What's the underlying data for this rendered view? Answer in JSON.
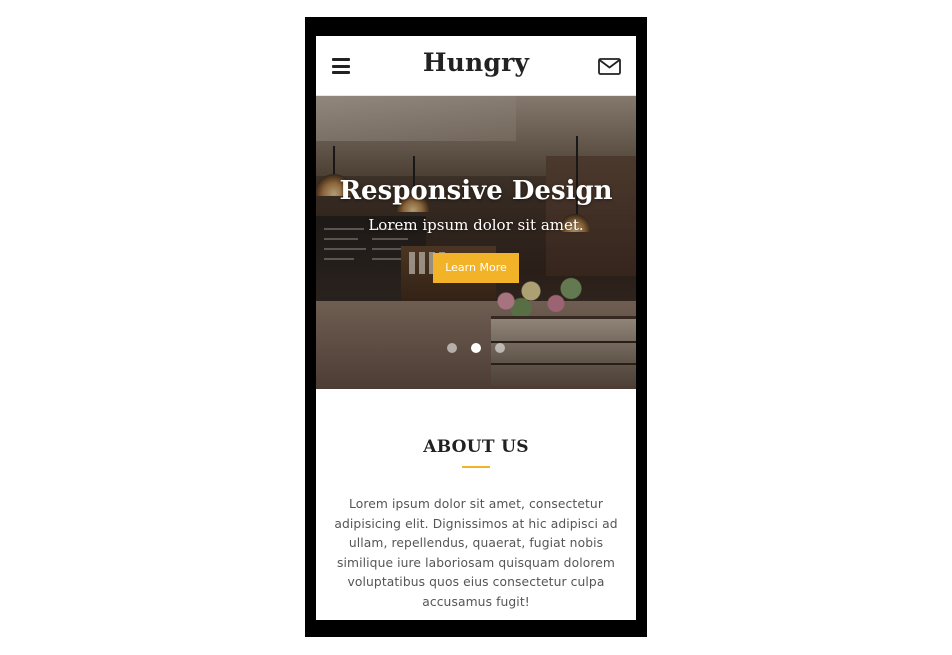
{
  "navbar": {
    "brand": "Hungry",
    "menu_icon": "hamburger-menu-icon",
    "mail_icon": "envelope-icon"
  },
  "hero": {
    "title": "Responsive Design",
    "subtitle": "Lorem ipsum dolor sit amet.",
    "button_label": "Learn More",
    "slide_count": 3,
    "active_slide": 2
  },
  "about": {
    "title": "ABOUT US",
    "body": "Lorem ipsum dolor sit amet, consectetur adipisicing elit. Dignissimos at hic adipisci ad ullam, repellendus, quaerat, fugiat nobis similique iure laboriosam quisquam dolorem voluptatibus quos eius consectetur culpa accusamus fugit!"
  },
  "colors": {
    "accent": "#f3b328",
    "text": "#222222",
    "body_text": "#555555",
    "device_frame": "#000000"
  }
}
